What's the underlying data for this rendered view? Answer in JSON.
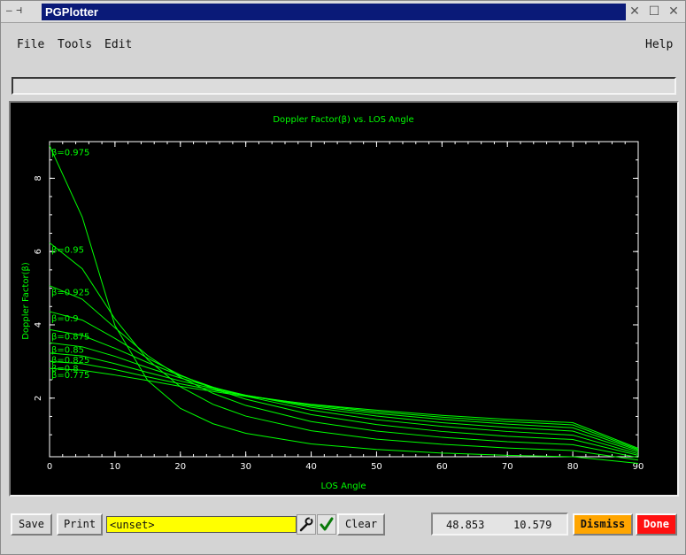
{
  "window": {
    "title": "PGPlotter",
    "left_glyphs": "—  ⊣ ",
    "controls": [
      "✕",
      "☐",
      "✕"
    ]
  },
  "menu": {
    "file": "File",
    "tools": "Tools",
    "edit": "Edit",
    "help": "Help"
  },
  "status_field_value": "",
  "chart_data": {
    "type": "line",
    "title": "Doppler Factor(β) vs. LOS Angle",
    "xlabel": "LOS Angle",
    "ylabel": "Doppler Factor(β)",
    "xlim": [
      0,
      90
    ],
    "ylim": [
      0.4,
      9.0
    ],
    "xticks": [
      0,
      10,
      20,
      30,
      40,
      50,
      60,
      70,
      80,
      90
    ],
    "yticks": [
      2,
      4,
      6,
      8
    ],
    "x": [
      0,
      5,
      10,
      15,
      20,
      25,
      30,
      40,
      50,
      60,
      70,
      80,
      90
    ],
    "series": [
      {
        "name": "β=0.975",
        "values": [
          8.89,
          6.94,
          3.98,
          2.48,
          1.72,
          1.3,
          1.04,
          0.75,
          0.6,
          0.5,
          0.44,
          0.4,
          0.22
        ]
      },
      {
        "name": "β=0.95",
        "values": [
          6.24,
          5.53,
          4.16,
          3.05,
          2.31,
          1.83,
          1.51,
          1.11,
          0.88,
          0.74,
          0.64,
          0.57,
          0.31
        ]
      },
      {
        "name": "β=0.925",
        "values": [
          5.07,
          4.7,
          3.92,
          3.16,
          2.57,
          2.13,
          1.8,
          1.36,
          1.1,
          0.93,
          0.81,
          0.73,
          0.38
        ]
      },
      {
        "name": "β=0.9",
        "values": [
          4.36,
          4.13,
          3.63,
          3.09,
          2.63,
          2.26,
          1.97,
          1.55,
          1.28,
          1.09,
          0.96,
          0.87,
          0.44
        ]
      },
      {
        "name": "β=0.875",
        "values": [
          3.87,
          3.71,
          3.36,
          2.97,
          2.61,
          2.3,
          2.05,
          1.67,
          1.41,
          1.23,
          1.09,
          0.99,
          0.48
        ]
      },
      {
        "name": "β=0.85",
        "values": [
          3.51,
          3.4,
          3.14,
          2.83,
          2.55,
          2.29,
          2.08,
          1.75,
          1.51,
          1.33,
          1.2,
          1.1,
          0.53
        ]
      },
      {
        "name": "β=0.825",
        "values": [
          3.23,
          3.15,
          2.94,
          2.7,
          2.47,
          2.26,
          2.08,
          1.79,
          1.58,
          1.42,
          1.29,
          1.19,
          0.57
        ]
      },
      {
        "name": "β=0.8",
        "values": [
          3.0,
          2.94,
          2.78,
          2.58,
          2.39,
          2.22,
          2.07,
          1.82,
          1.63,
          1.48,
          1.36,
          1.27,
          0.6
        ]
      },
      {
        "name": "β=0.775",
        "values": [
          2.81,
          2.76,
          2.63,
          2.48,
          2.32,
          2.18,
          2.05,
          1.83,
          1.67,
          1.53,
          1.42,
          1.33,
          0.63
        ]
      }
    ]
  },
  "bottom": {
    "save_label": "Save",
    "print_label": "Print",
    "command_value": "<unset>",
    "clear_label": "Clear",
    "coord_x": "48.853",
    "coord_y": "10.579",
    "dismiss_label": "Dismiss",
    "done_label": "Done"
  },
  "colors": {
    "plot_bg": "#000000",
    "curve": "#00ff00",
    "axis": "#ffffff",
    "titlebar": "#0a1a78",
    "input_bg": "#ffff00",
    "dismiss": "#ffa500",
    "done": "#ff1010"
  }
}
